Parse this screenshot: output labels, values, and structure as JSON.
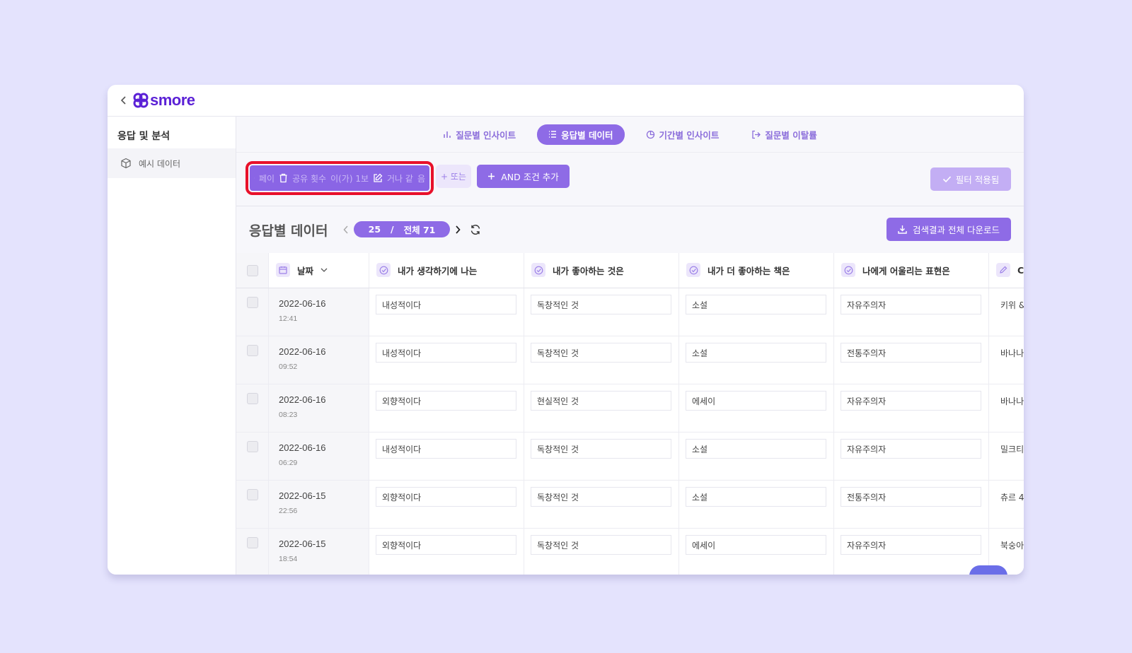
{
  "app": {
    "brand": "smore"
  },
  "sidebar": {
    "title": "응답 및 분석",
    "items": [
      {
        "label": "예시 데이터",
        "icon": "cube-icon"
      }
    ]
  },
  "tabs": [
    {
      "label": "질문별 인사이트",
      "icon": "bar-chart-icon",
      "active": false
    },
    {
      "label": "응답별 데이터",
      "icon": "list-icon",
      "active": true
    },
    {
      "label": "기간별 인사이트",
      "icon": "pie-chart-icon",
      "active": false
    },
    {
      "label": "질문별 이탈률",
      "icon": "exit-icon",
      "active": false
    }
  ],
  "filter": {
    "chip_segments": [
      "페이",
      "공유 횟수",
      "이(가) 1보",
      "거나 같",
      "음"
    ],
    "or_label": "+ 또는",
    "and_label": "AND 조건 추가",
    "applied_label": "필터 적용됨"
  },
  "section": {
    "title": "응답별 데이터",
    "pager_current": "25",
    "pager_sep": "/",
    "pager_total": "전체 71",
    "download_label": "검색결과 전체 다운로드"
  },
  "table": {
    "date_header": "날짜",
    "columns": [
      "내가 생각하기에 나는",
      "내가 좋아하는 것은",
      "내가 더 좋아하는 책은",
      "나에게 어울리는 표현은",
      "C"
    ],
    "rows": [
      {
        "date": "2022-06-16",
        "time": "12:41",
        "answers": [
          "내성적이다",
          "독창적인 것",
          "소설",
          "자유주의자",
          "키위 &"
        ]
      },
      {
        "date": "2022-06-16",
        "time": "09:52",
        "answers": [
          "내성적이다",
          "독창적인 것",
          "소설",
          "전통주의자",
          "바나나"
        ]
      },
      {
        "date": "2022-06-16",
        "time": "08:23",
        "answers": [
          "외향적이다",
          "현실적인 것",
          "에세이",
          "자유주의자",
          "바나나"
        ]
      },
      {
        "date": "2022-06-16",
        "time": "06:29",
        "answers": [
          "내성적이다",
          "독창적인 것",
          "소설",
          "자유주의자",
          "밀크티"
        ]
      },
      {
        "date": "2022-06-15",
        "time": "22:56",
        "answers": [
          "외향적이다",
          "독창적인 것",
          "소설",
          "전통주의자",
          "츄르 4"
        ]
      },
      {
        "date": "2022-06-15",
        "time": "18:54",
        "answers": [
          "외향적이다",
          "독창적인 것",
          "에세이",
          "자유주의자",
          "북숭아"
        ]
      }
    ]
  },
  "colors": {
    "accent": "#8e6be6",
    "brand": "#5b21d6",
    "highlight_border": "#e8112a",
    "background": "#e4e3fd"
  }
}
